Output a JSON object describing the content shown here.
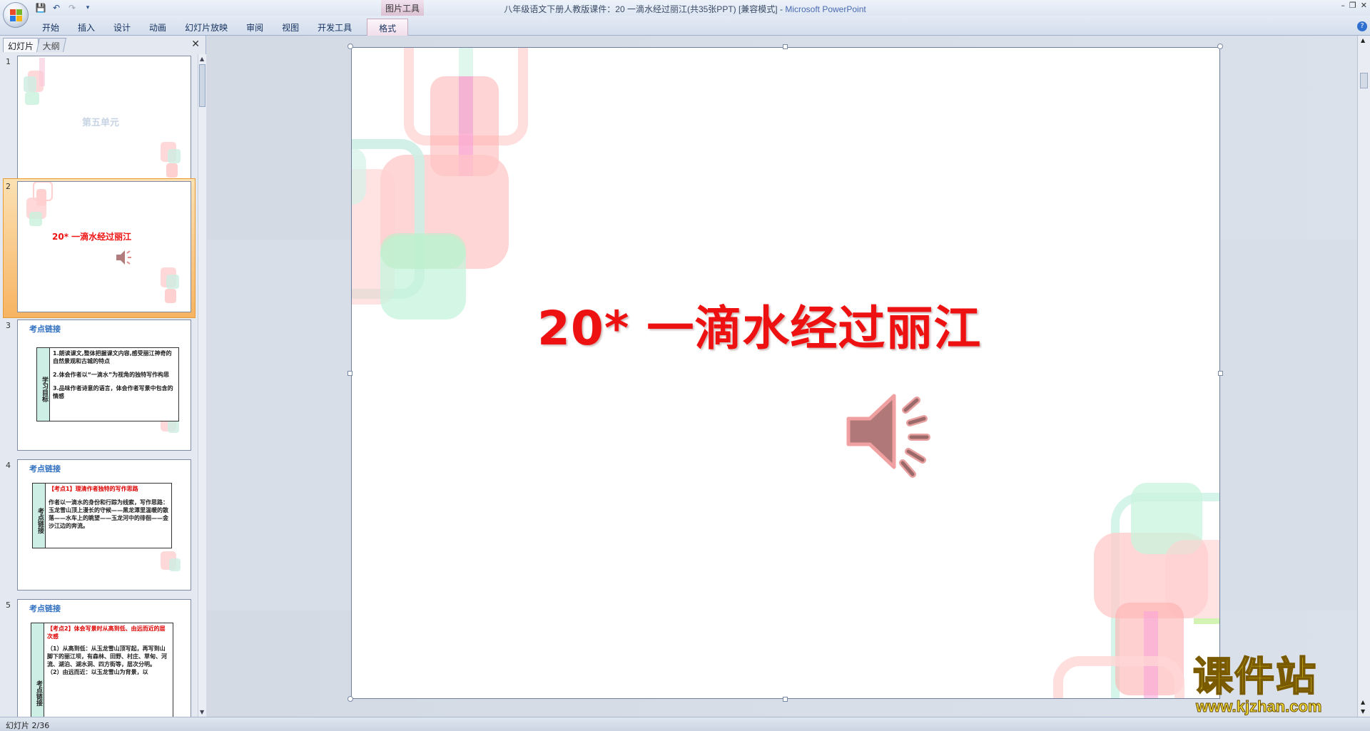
{
  "window": {
    "title": "八年级语文下册人教版课件：20 一滴水经过丽江(共35张PPT) [兼容模式]",
    "separator": " - ",
    "app_name": "Microsoft PowerPoint",
    "context_group": "图片工具"
  },
  "quick_access": [
    "save-icon",
    "undo-icon",
    "redo-icon",
    "customize-icon"
  ],
  "ribbon": {
    "tabs": [
      "开始",
      "插入",
      "设计",
      "动画",
      "幻灯片放映",
      "审阅",
      "视图",
      "开发工具"
    ],
    "context_tab": "格式"
  },
  "pane": {
    "tab_slides": "幻灯片",
    "tab_outline": "大纲"
  },
  "thumbnails": [
    {
      "num": "1",
      "title": "第五单元"
    },
    {
      "num": "2",
      "title": "20* 一滴水经过丽江"
    },
    {
      "num": "3",
      "heading": "考点链接",
      "side": "学习目标",
      "lines": [
        "1.朗读课文,整体把握课文内容,感受丽江神奇的自然景观和古城的特点",
        "2.体会作者以“一滴水”为视角的独特写作构思",
        "3.品味作者诗意的语言，体会作者写景中包含的情感"
      ]
    },
    {
      "num": "4",
      "heading": "考点链接",
      "side": "考点链接",
      "red": "【考点1】理清作者独特的写作思路",
      "lines": [
        "作者以一滴水的身份和行踪为线索，写作思路：玉龙雪山顶上漫长的守候——黑龙潭里温暖的散落——水车上的眺望——玉龙河中的徘徊——金沙江边的奔流。"
      ]
    },
    {
      "num": "5",
      "heading": "考点链接",
      "side": "考点链接",
      "red": "【考点2】体会写景时从高到低、由远而近的层次感",
      "lines": [
        "（1）从高到低：从玉龙雪山顶写起，再写到山脚下的丽江坝，有森林、田野、村庄、草甸、河流、湖泊、湖水洞、四方街等，层次分明。",
        "（2）由远而近：以玉龙雪山为背景，以"
      ]
    }
  ],
  "slide": {
    "title": "20*  一滴水经过丽江"
  },
  "status": {
    "text": "幻灯片 2/36"
  },
  "watermark": {
    "big": "课件站",
    "small": "www.kjzhan.com"
  },
  "colors": {
    "title_red": "#ee1111",
    "thumb_heading_blue": "#2f6fbf",
    "selection_orange": "#f7b463"
  }
}
